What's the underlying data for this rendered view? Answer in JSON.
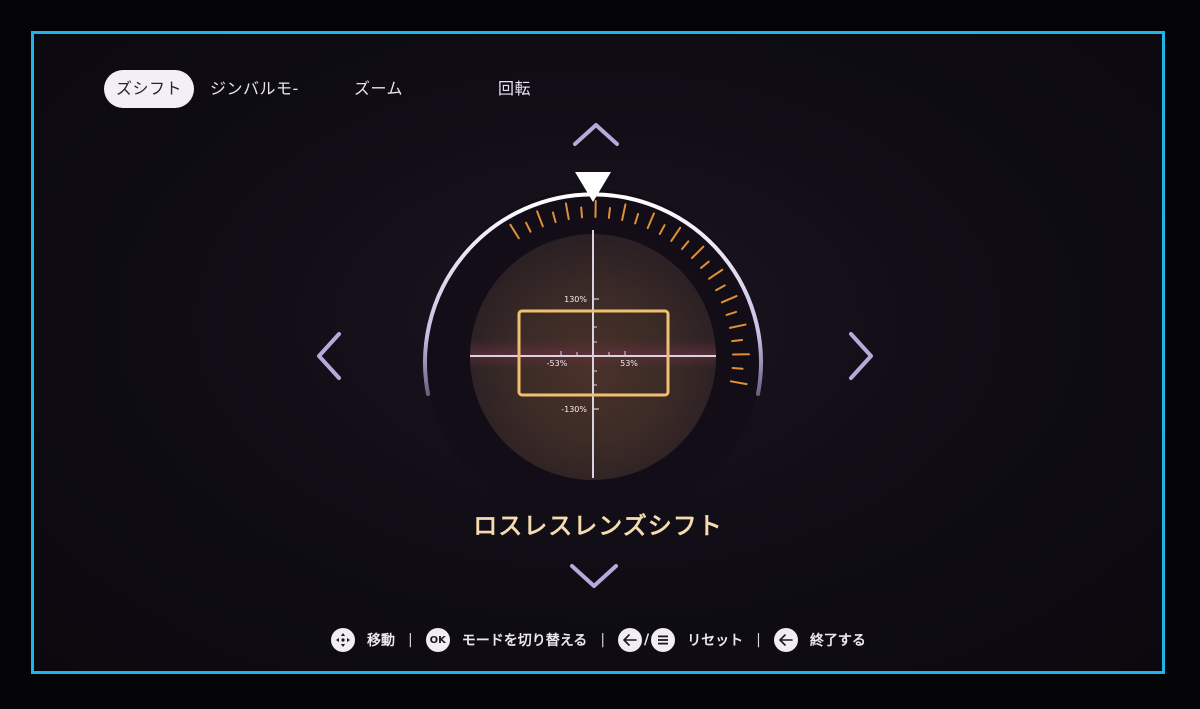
{
  "tabs": [
    {
      "label": "ズシフト",
      "active": true
    },
    {
      "label": "ジンバルモ-",
      "active": false
    },
    {
      "label": "ズーム",
      "active": false
    },
    {
      "label": "回転",
      "active": false
    }
  ],
  "crosshair": {
    "top_label": "130%",
    "bottom_label": "-130%",
    "left_label": "-53%",
    "right_label": "53%"
  },
  "mode_title": "ロスレスレンズシフト",
  "hints": {
    "move_label": "移動",
    "ok_icon_text": "OK",
    "ok_label": "モードを切り替える",
    "separator": "|",
    "slash": "/",
    "reset_label": "リセット",
    "exit_label": "終了する"
  },
  "colors": {
    "frame": "#1fb4ea",
    "accent": "#f0c070",
    "tick_orange": "#e0903a",
    "arrow": "#b7a9d9"
  },
  "icons": [
    "dpad-icon",
    "back-arrow-icon",
    "menu-icon",
    "chevron-up-icon",
    "chevron-down-icon",
    "chevron-left-icon",
    "chevron-right-icon",
    "pointer-triangle-icon"
  ]
}
